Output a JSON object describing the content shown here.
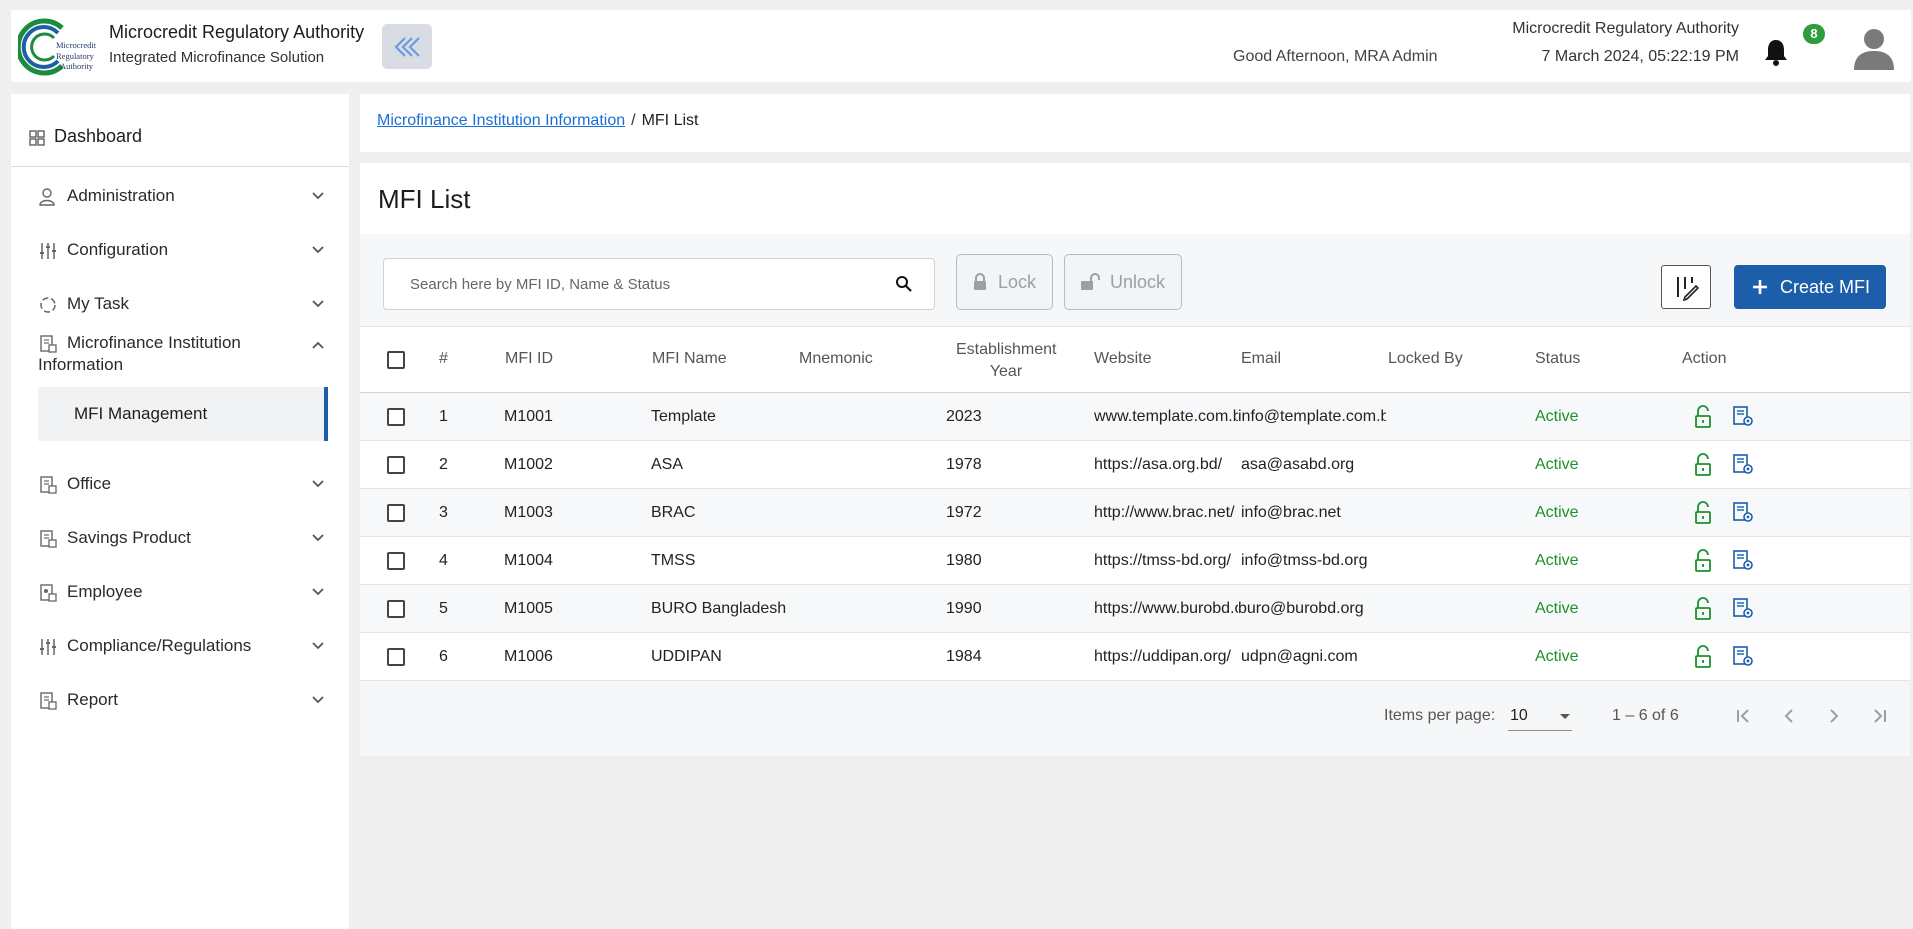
{
  "header": {
    "logo_text": [
      "Microcredit",
      "Regulatory",
      "Authority"
    ],
    "app_title": "Microcredit Regulatory Authority",
    "app_subtitle": "Integrated Microfinance Solution",
    "greeting": "Good Afternoon, MRA Admin",
    "org_name": "Microcredit Regulatory Authority",
    "datetime": "7 March 2024, 05:22:19 PM",
    "notification_count": "8"
  },
  "sidebar": {
    "dashboard": "Dashboard",
    "items": [
      {
        "label": "Administration"
      },
      {
        "label": "Configuration"
      },
      {
        "label": "My Task"
      },
      {
        "label": "Microfinance Institution Information",
        "expanded": true
      },
      {
        "label": "Office"
      },
      {
        "label": "Savings Product"
      },
      {
        "label": "Employee"
      },
      {
        "label": "Compliance/Regulations"
      },
      {
        "label": "Report"
      }
    ],
    "active_sub_item": "MFI Management"
  },
  "breadcrumb": {
    "parent": "Microfinance Institution Information",
    "separator": "/",
    "current": "MFI List"
  },
  "page": {
    "title": "MFI List",
    "search_placeholder": "Search here by MFI ID, Name & Status",
    "lock_label": "Lock",
    "unlock_label": "Unlock",
    "create_label": "Create MFI"
  },
  "table": {
    "columns": {
      "index": "#",
      "mfi_id": "MFI ID",
      "mfi_name": "MFI Name",
      "mnemonic": "Mnemonic",
      "est_year_1": "Establishment",
      "est_year_2": "Year",
      "website": "Website",
      "email": "Email",
      "locked_by": "Locked By",
      "status": "Status",
      "action": "Action"
    },
    "rows": [
      {
        "index": "1",
        "mfi_id": "M1001",
        "mfi_name": "Template",
        "mnemonic": "",
        "year": "2023",
        "website": "www.template.com.bd",
        "email": "info@template.com.bd",
        "locked_by": "",
        "status": "Active"
      },
      {
        "index": "2",
        "mfi_id": "M1002",
        "mfi_name": "ASA",
        "mnemonic": "",
        "year": "1978",
        "website": "https://asa.org.bd/",
        "email": "asa@asabd.org",
        "locked_by": "",
        "status": "Active"
      },
      {
        "index": "3",
        "mfi_id": "M1003",
        "mfi_name": "BRAC",
        "mnemonic": "",
        "year": "1972",
        "website": "http://www.brac.net/",
        "email": "info@brac.net",
        "locked_by": "",
        "status": "Active"
      },
      {
        "index": "4",
        "mfi_id": "M1004",
        "mfi_name": "TMSS",
        "mnemonic": "",
        "year": "1980",
        "website": "https://tmss-bd.org/",
        "email": "info@tmss-bd.org",
        "locked_by": "",
        "status": "Active"
      },
      {
        "index": "5",
        "mfi_id": "M1005",
        "mfi_name": "BURO Bangladesh",
        "mnemonic": "",
        "year": "1990",
        "website": "https://www.burobd.org",
        "email": "buro@burobd.org",
        "locked_by": "",
        "status": "Active"
      },
      {
        "index": "6",
        "mfi_id": "M1006",
        "mfi_name": "UDDIPAN",
        "mnemonic": "",
        "year": "1984",
        "website": "https://uddipan.org/",
        "email": "udpn@agni.com",
        "locked_by": "",
        "status": "Active"
      }
    ]
  },
  "paginator": {
    "items_per_page_label": "Items per page:",
    "items_per_page": "10",
    "range": "1 – 6 of 6"
  },
  "colors": {
    "primary": "#1c5ea9",
    "status_active": "#1e8f2e",
    "link": "#1a6fd8",
    "badge": "#2e9d3e"
  }
}
